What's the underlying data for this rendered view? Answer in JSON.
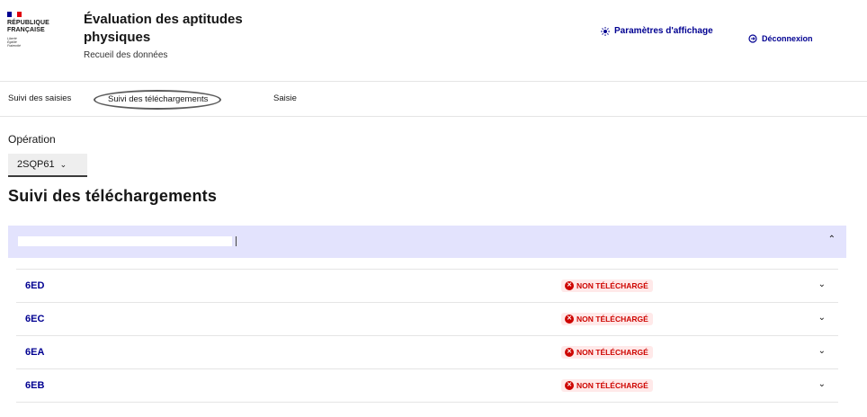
{
  "header": {
    "logo_lines": [
      "RÉPUBLIQUE",
      "FRANÇAISE"
    ],
    "logo_devise": [
      "Liberté",
      "Égalité",
      "Fraternité"
    ],
    "title": "Évaluation des aptitudes physiques",
    "subtitle": "Recueil des données",
    "settings_label": "Paramètres d'affichage",
    "logout_label": "Déconnexion",
    "colors": {
      "accent": "#000091",
      "flag_blue": "#000091",
      "flag_red": "#e1000f"
    }
  },
  "nav": {
    "items": [
      {
        "label": "Suivi des saisies"
      },
      {
        "label": "Suivi des téléchargements",
        "active": true
      },
      {
        "label": "Saisie"
      }
    ]
  },
  "operation": {
    "label": "Opération",
    "selected": "2SQP61"
  },
  "page_title": "Suivi des téléchargements",
  "accordion": {
    "header_value": "",
    "expanded": true,
    "colors": {
      "header_bg": "#e3e3fd"
    }
  },
  "rows": [
    {
      "name": "6ED",
      "status": "NON TÉLÉCHARGÉ"
    },
    {
      "name": "6EC",
      "status": "NON TÉLÉCHARGÉ"
    },
    {
      "name": "6EA",
      "status": "NON TÉLÉCHARGÉ"
    },
    {
      "name": "6EB",
      "status": "NON TÉLÉCHARGÉ"
    }
  ],
  "status_colors": {
    "error_text": "#ce0500",
    "error_bg": "#ffe9e9"
  },
  "icons": {
    "settings": "sun-icon",
    "logout": "logout-icon",
    "status": "error-circle-icon",
    "expand": "chevron-down-icon",
    "collapse": "chevron-up-icon"
  }
}
